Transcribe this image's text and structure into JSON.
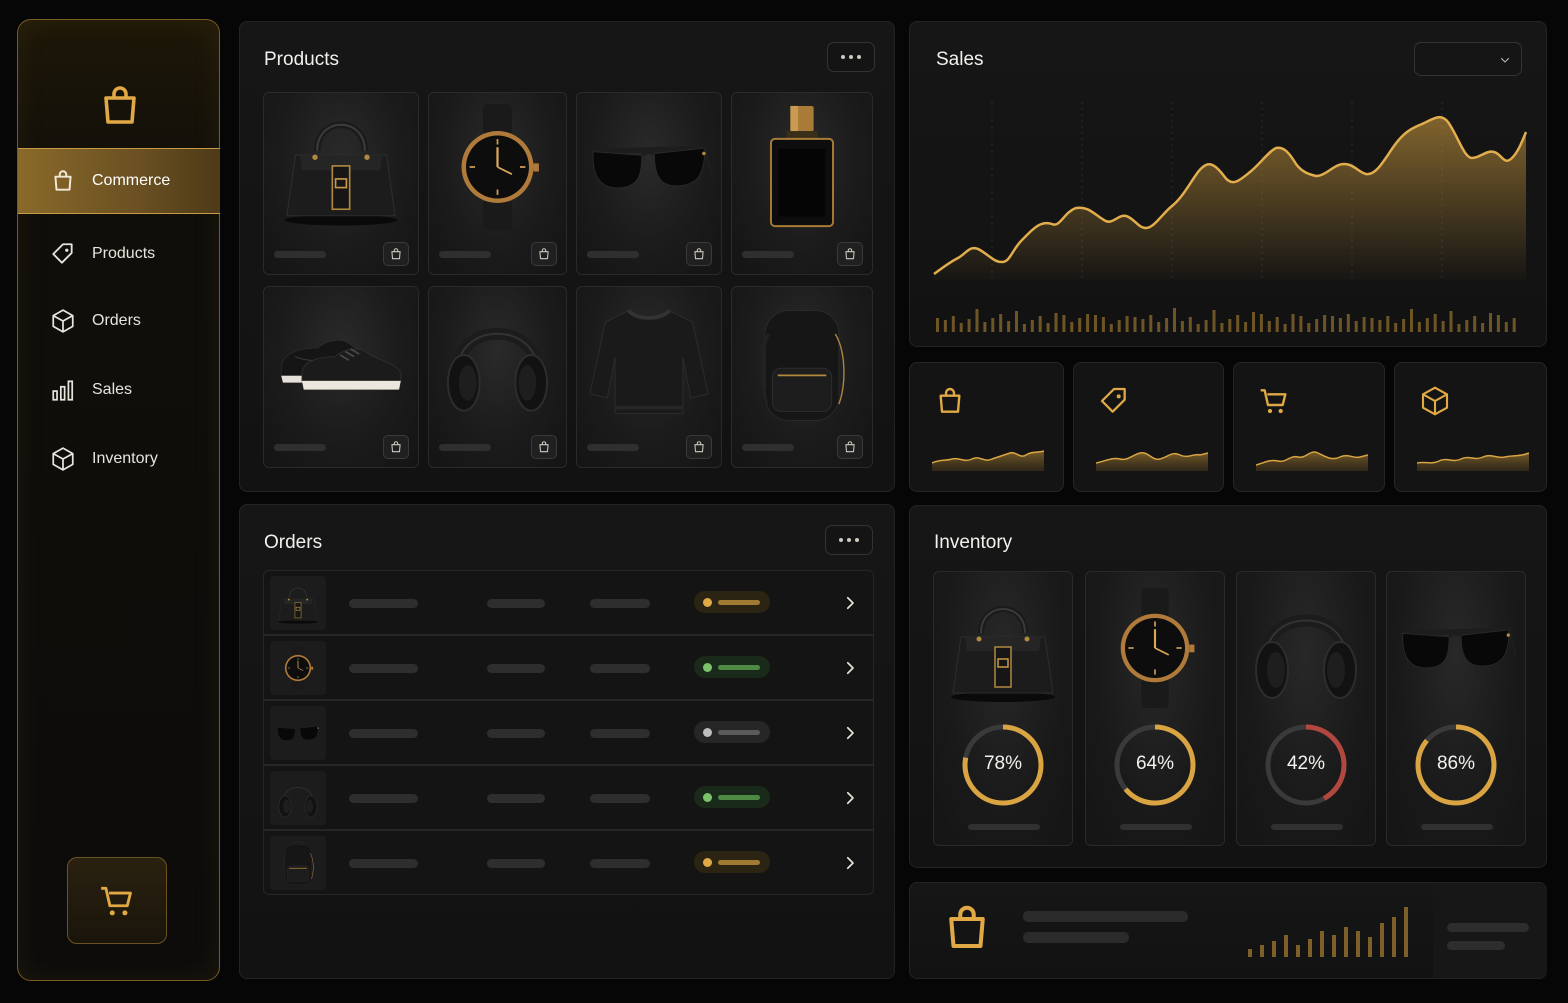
{
  "colors": {
    "accent": "#d9a441",
    "green": "#7ac36a",
    "grey": "#bdbdbd",
    "red": "#b2473f"
  },
  "sidebar": {
    "logo_icon": "shopping-bag-icon",
    "items": [
      {
        "label": "Commerce",
        "icon": "shopping-bag-icon",
        "active": true
      },
      {
        "label": "Products",
        "icon": "tag-icon"
      },
      {
        "label": "Orders",
        "icon": "box-icon"
      },
      {
        "label": "Sales",
        "icon": "bar-chart-icon"
      },
      {
        "label": "Inventory",
        "icon": "box-icon"
      }
    ],
    "cart_icon": "cart-icon"
  },
  "products": {
    "title": "Products",
    "items": [
      {
        "image": "handbag"
      },
      {
        "image": "watch"
      },
      {
        "image": "sunglasses"
      },
      {
        "image": "perfume"
      },
      {
        "image": "sneakers"
      },
      {
        "image": "headphones"
      },
      {
        "image": "sweater"
      },
      {
        "image": "backpack"
      }
    ]
  },
  "orders": {
    "title": "Orders",
    "rows": [
      {
        "image": "handbag",
        "status": "yellow"
      },
      {
        "image": "watch",
        "status": "green"
      },
      {
        "image": "sunglasses",
        "status": "grey"
      },
      {
        "image": "headphones",
        "status": "green"
      },
      {
        "image": "backpack",
        "status": "yellow"
      }
    ]
  },
  "sales": {
    "title": "Sales",
    "dropdown_value": "",
    "stats": [
      {
        "icon": "shopping-bag-icon"
      },
      {
        "icon": "tag-icon"
      },
      {
        "icon": "cart-icon"
      },
      {
        "icon": "box-icon"
      }
    ]
  },
  "inventory": {
    "title": "Inventory",
    "items": [
      {
        "image": "handbag",
        "percent": 78,
        "label": "78%",
        "color": "#d9a441"
      },
      {
        "image": "watch",
        "percent": 64,
        "label": "64%",
        "color": "#d9a441"
      },
      {
        "image": "headphones",
        "percent": 42,
        "label": "42%",
        "color": "#b2473f"
      },
      {
        "image": "sunglasses",
        "percent": 86,
        "label": "86%",
        "color": "#d9a441"
      }
    ]
  }
}
